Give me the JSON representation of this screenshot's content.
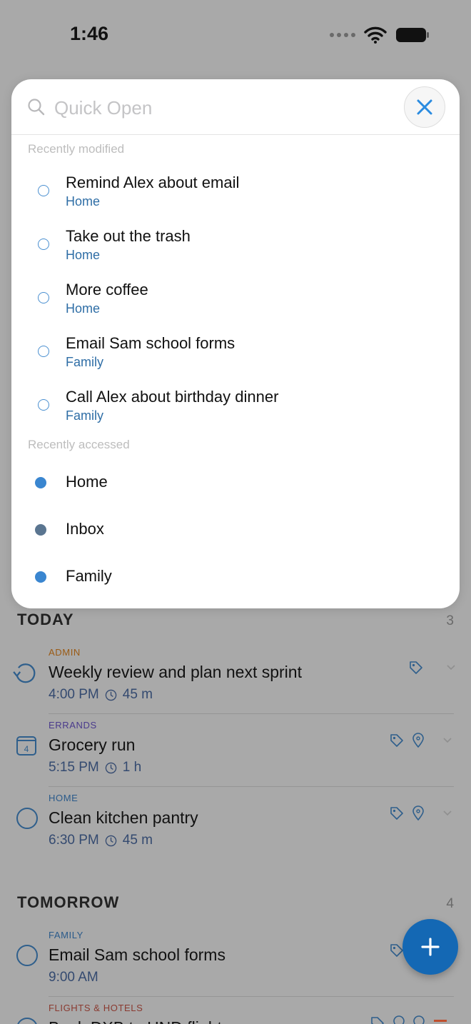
{
  "status_bar": {
    "time": "1:46"
  },
  "quick_open": {
    "search_placeholder": "Quick Open",
    "recently_modified_label": "Recently modified",
    "recently_modified": [
      {
        "title": "Remind Alex about email",
        "project": "Home"
      },
      {
        "title": "Take out the trash",
        "project": "Home"
      },
      {
        "title": "More coffee",
        "project": "Home"
      },
      {
        "title": "Email Sam school forms",
        "project": "Family"
      },
      {
        "title": "Call Alex about birthday dinner",
        "project": "Family"
      }
    ],
    "recently_accessed_label": "Recently accessed",
    "recently_accessed": [
      {
        "label": "Home",
        "color": "#3a86d0"
      },
      {
        "label": "Inbox",
        "color": "#5a7590"
      },
      {
        "label": "Family",
        "color": "#3a86d0"
      }
    ]
  },
  "today": {
    "title": "TODAY",
    "count": "3",
    "tasks": [
      {
        "category": "ADMIN",
        "category_color": "#9a5a14",
        "title": "Weekly review and plan next sprint",
        "time": "4:00 PM",
        "duration": "45 m",
        "icon": "repeat-icon"
      },
      {
        "category": "ERRANDS",
        "category_color": "#4a3a8c",
        "title": "Grocery run",
        "time": "5:15 PM",
        "duration": "1 h",
        "icon": "calendar-icon",
        "calendar_day": "4"
      },
      {
        "category": "HOME",
        "category_color": "#2a5a8a",
        "title": "Clean kitchen pantry",
        "time": "6:30 PM",
        "duration": "45 m",
        "icon": "circle-icon"
      }
    ]
  },
  "tomorrow": {
    "title": "TOMORROW",
    "count": "4",
    "tasks": [
      {
        "category": "FAMILY",
        "category_color": "#2a5a8a",
        "title": "Email Sam school forms",
        "time": "9:00 AM"
      },
      {
        "category": "FLIGHTS & HOTELS",
        "category_color": "#8a3a30",
        "title": "Book DXB to HND flight"
      }
    ]
  }
}
